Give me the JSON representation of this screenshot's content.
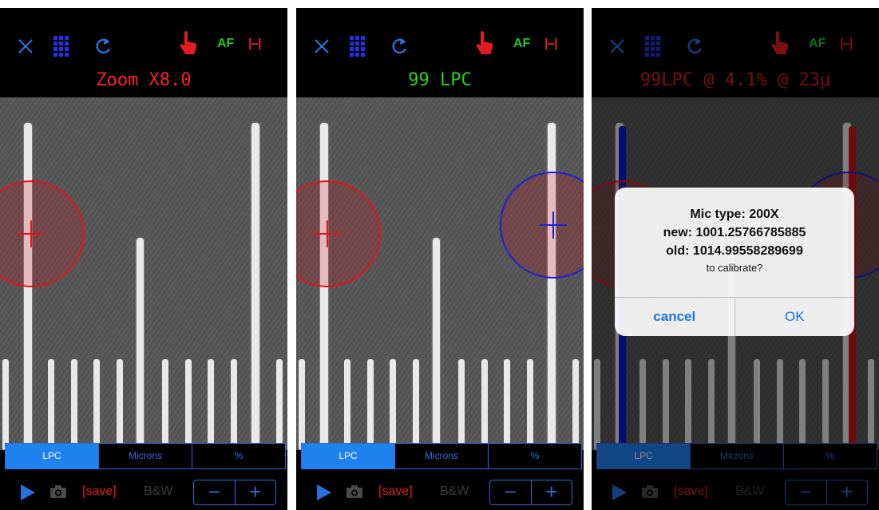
{
  "colors": {
    "blue_accent": "#2a6fe0",
    "red": "#e21d22",
    "green": "#25c41f",
    "background": "#000000"
  },
  "toolbar": {
    "close_icon": "close-icon",
    "grid_icon": "grid-icon",
    "refresh_icon": "refresh-icon",
    "hand_icon": "hand-pointer-icon",
    "af_label": "AF",
    "ruler_label": "|--|"
  },
  "panels": [
    {
      "readout": "Zoom X8.0",
      "readout_color": "#ff2020"
    },
    {
      "readout": "99 LPC",
      "readout_color": "#28d11e"
    },
    {
      "readout": "99LPC @ 4.1% @ 23μ",
      "readout_color": "#e0161f"
    }
  ],
  "segments": [
    "LPC",
    "Microns",
    "%"
  ],
  "selected_segment": "LPC",
  "bottom": {
    "save_label": "[save]",
    "bw_label": "B&W",
    "minus_label": "−",
    "plus_label": "+"
  },
  "alert": {
    "line1": "Mic type: 200X",
    "line2": "new: 1001.25766785885",
    "line3": "old: 1014.99558289699",
    "message": "to calibrate?",
    "cancel_label": "cancel",
    "ok_label": "OK"
  }
}
